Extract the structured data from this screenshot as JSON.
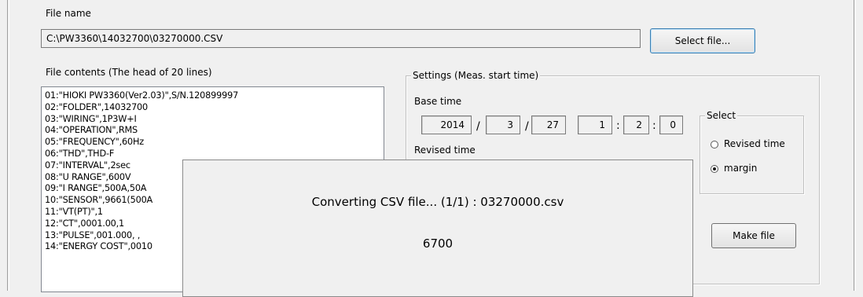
{
  "file": {
    "name_label": "File name",
    "path_value": "C:\\PW3360\\14032700\\03270000.CSV",
    "select_button": "Select file..."
  },
  "contents": {
    "label": "File contents (The head of 20 lines)",
    "lines": [
      "01:\"HIOKI PW3360(Ver2.03)\",S/N.120899997",
      "02:\"FOLDER\",14032700",
      "03:\"WIRING\",1P3W+I",
      "04:\"OPERATION\",RMS",
      "05:\"FREQUENCY\",60Hz",
      "06:\"THD\",THD-F",
      "07:\"INTERVAL\",2sec",
      "08:\"U RANGE\",600V",
      "09:\"I RANGE\",500A,50A",
      "10:\"SENSOR\",9661(500A",
      "11:\"VT(PT)\",1",
      "12:\"CT\",0001.00,1",
      "13:\"PULSE\",001.000, ,",
      "14:\"ENERGY COST\",0010"
    ]
  },
  "settings": {
    "legend": "Settings (Meas. start time)",
    "base_time_label": "Base time",
    "base_time": {
      "year": "2014",
      "month": "3",
      "day": "27",
      "hour": "1",
      "minute": "2",
      "second": "0",
      "date_sep": "/",
      "time_sep": ":"
    },
    "revised_time_label": "Revised time"
  },
  "select_group": {
    "legend": "Select",
    "options": [
      {
        "label": "Revised time",
        "checked": false
      },
      {
        "label": "margin",
        "checked": true
      }
    ]
  },
  "make_file_button": "Make file",
  "progress_dialog": {
    "message": "Converting CSV file... (1/1) : 03270000.csv",
    "count": "6700"
  }
}
